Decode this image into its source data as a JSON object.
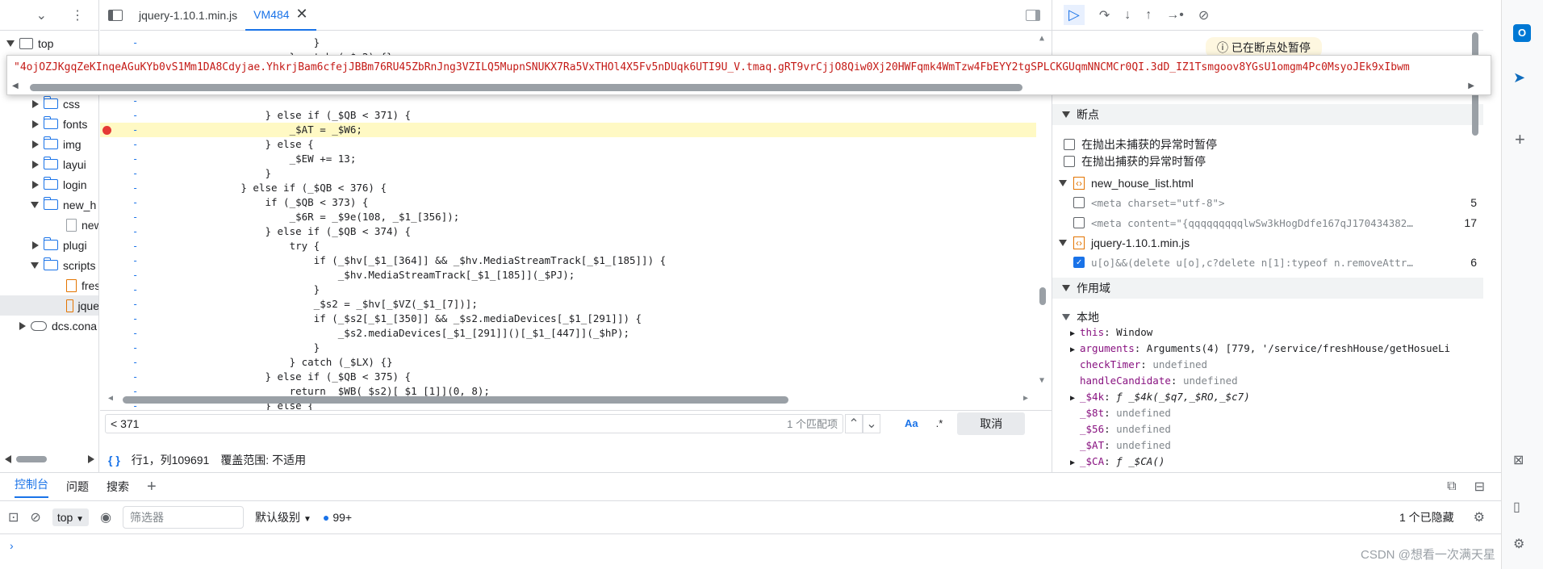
{
  "navigator": {
    "top_label": "top",
    "items": [
      {
        "label": "css"
      },
      {
        "label": "fonts"
      },
      {
        "label": "img"
      },
      {
        "label": "layui"
      },
      {
        "label": "login"
      },
      {
        "label": "new_h"
      },
      {
        "label": "new"
      },
      {
        "label": "plugi"
      },
      {
        "label": "scripts"
      },
      {
        "label": "fres"
      },
      {
        "label": "jque"
      },
      {
        "label": "dcs.cona"
      }
    ]
  },
  "tabs": [
    {
      "label": "jquery-1.10.1.min.js"
    },
    {
      "label": "VM484"
    }
  ],
  "tooltip": {
    "value": "\"4ojOZJKgqZeKInqeAGuKYb0vS1Mm1DA8Cdyjae.YhkrjBam6cfejJBBm76RU45ZbRnJng3VZILQ5MupnSNUKX7Ra5VxTHOl4X5Fv5nDUqk6UTI9U_V.tmaq.gRT9vrCjjO8Qiw0Xj20HWFqmk4WmTzw4FbEYY2tgSPLCKGUqmNNCMCr0QI.3dD_IZ1Tsmgoov8YGsU1omgm4Pc0MsyoJEk9xIbwm"
  },
  "code_lines": [
    {
      "ln": "-",
      "text": "                          }"
    },
    {
      "ln": "-",
      "text": "                      } catch (_$e2) {}"
    },
    {
      "ln": "-",
      "text": ""
    },
    {
      "ln": "-",
      "text": ""
    },
    {
      "ln": "-",
      "text": ""
    },
    {
      "ln": "-",
      "text": "                  } else if (_$QB < 371) {"
    },
    {
      "ln": "-",
      "text": "                      _$AT = _$W6;"
    },
    {
      "ln": "-",
      "text": "                  } else {"
    },
    {
      "ln": "-",
      "text": "                      _$EW += 13;"
    },
    {
      "ln": "-",
      "text": "                  }"
    },
    {
      "ln": "-",
      "text": "              } else if (_$QB < 376) {"
    },
    {
      "ln": "-",
      "text": "                  if (_$QB < 373) {"
    },
    {
      "ln": "-",
      "text": "                      _$6R = _$9e(108, _$1_[356]);"
    },
    {
      "ln": "-",
      "text": "                  } else if (_$QB < 374) {"
    },
    {
      "ln": "-",
      "text": "                      try {"
    },
    {
      "ln": "-",
      "text": "                          if (_$hv[_$1_[364]] && _$hv.MediaStreamTrack[_$1_[185]]) {"
    },
    {
      "ln": "-",
      "text": "                              _$hv.MediaStreamTrack[_$1_[185]](_$PJ);"
    },
    {
      "ln": "-",
      "text": "                          }"
    },
    {
      "ln": "-",
      "text": "                          _$s2 = _$hv[_$VZ(_$1_[7])];"
    },
    {
      "ln": "-",
      "text": "                          if (_$s2[_$1_[350]] && _$s2.mediaDevices[_$1_[291]]) {"
    },
    {
      "ln": "-",
      "text": "                              _$s2.mediaDevices[_$1_[291]]()[_$1_[447]](_$hP);"
    },
    {
      "ln": "-",
      "text": "                          }"
    },
    {
      "ln": "-",
      "text": "                      } catch (_$LX) {}"
    },
    {
      "ln": "-",
      "text": "                  } else if (_$QB < 375) {"
    },
    {
      "ln": "-",
      "text": "                      return _$WB(_$s2)[_$1_[1]](0, 8);"
    },
    {
      "ln": "-",
      "text": "                  } else {"
    }
  ],
  "search": {
    "query": "< 371",
    "match_count": "1 个匹配项",
    "case_label": "Aa",
    "regex_label": ".*",
    "cancel_label": "取消"
  },
  "status": {
    "brace": "{ }",
    "position": "行1，列109691",
    "coverage": "覆盖范围: 不适用"
  },
  "debugger": {
    "paused_badge": "已在断点处暂停",
    "breakpoints_title": "断点",
    "pause_uncaught": "在抛出未捕获的异常时暂停",
    "pause_caught": "在抛出捕获的异常时暂停",
    "bp_groups": [
      {
        "file": "new_house_list.html",
        "entries": [
          {
            "code": "<meta charset=\"utf-8\">",
            "line": "5",
            "checked": false
          },
          {
            "code": "<meta content=\"{qqqqqqqqqlwSw3kHogDdfe167qJ170434382…",
            "line": "17",
            "checked": false
          }
        ]
      },
      {
        "file": "jquery-1.10.1.min.js",
        "entries": [
          {
            "code": "u[o]&&(delete u[o],c?delete n[1]:typeof n.removeAttr…",
            "line": "6",
            "checked": true
          }
        ]
      }
    ],
    "scope_title": "作用域",
    "local_title": "本地",
    "scope_vars": [
      {
        "key": "this",
        "value": "Window",
        "kind": "plain",
        "expandable": true
      },
      {
        "key": "arguments",
        "value": "Arguments(4) [779, '/service/freshHouse/getHosueLi",
        "kind": "plain",
        "expandable": true
      },
      {
        "key": "checkTimer",
        "value": "undefined",
        "kind": "undef",
        "expandable": false
      },
      {
        "key": "handleCandidate",
        "value": "undefined",
        "kind": "undef",
        "expandable": false
      },
      {
        "key": "_$4k",
        "value": "ƒ _$4k(_$q7,_$RO,_$c7)",
        "kind": "fn",
        "expandable": true
      },
      {
        "key": "_$8t",
        "value": "undefined",
        "kind": "undef",
        "expandable": false
      },
      {
        "key": "_$56",
        "value": "undefined",
        "kind": "undef",
        "expandable": false
      },
      {
        "key": "_$AT",
        "value": "undefined",
        "kind": "undef",
        "expandable": false
      },
      {
        "key": "_$CA",
        "value": "ƒ _$CA()",
        "kind": "fn",
        "expandable": true
      }
    ]
  },
  "drawer": {
    "tabs": [
      "控制台",
      "问题",
      "搜索"
    ],
    "context": "top",
    "filter_placeholder": "筛选器",
    "level": "默认级别",
    "issues_count": "99+",
    "hidden_count": "1 个已隐藏"
  },
  "watermark": "CSDN @想看一次满天星"
}
